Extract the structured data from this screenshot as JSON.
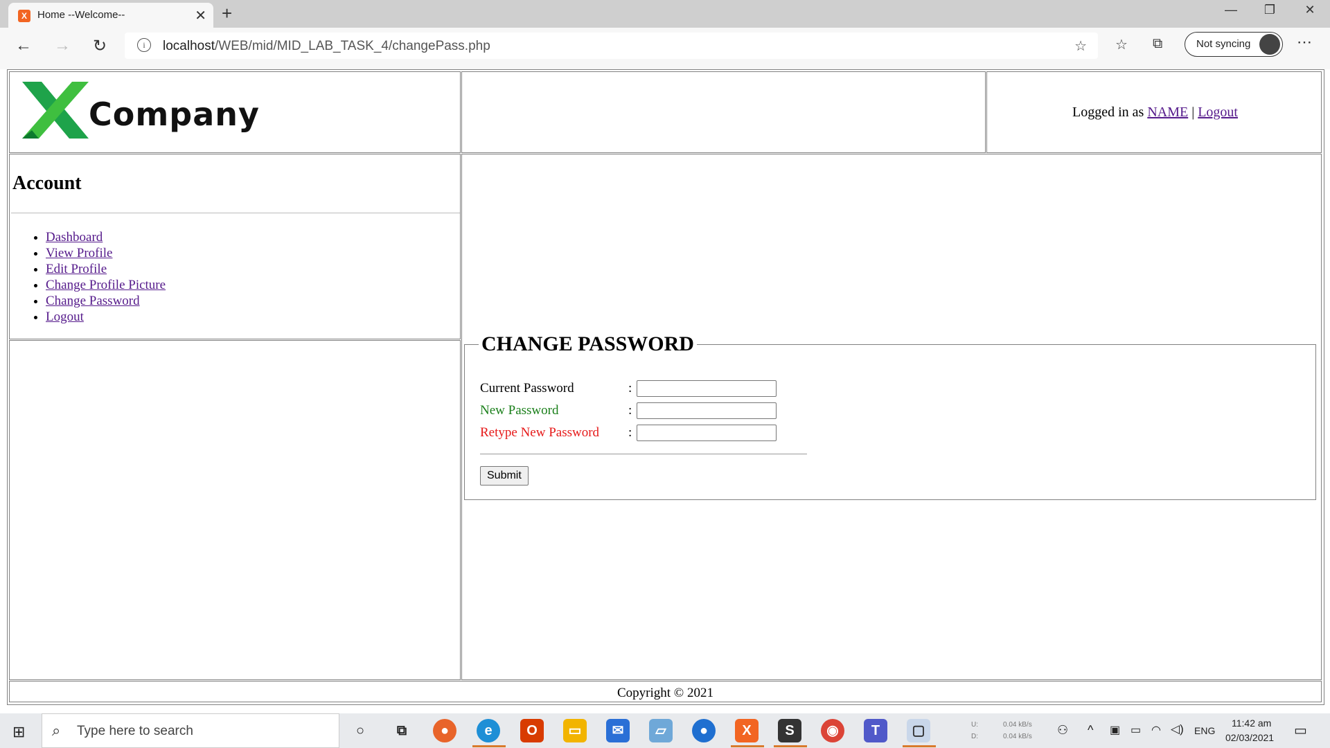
{
  "browser": {
    "tab_title": "Home --Welcome--",
    "tab_favicon_letter": "X",
    "url_host": "localhost",
    "url_path": "/WEB/mid/MID_LAB_TASK_4/changePass.php",
    "sync_label": "Not syncing"
  },
  "header": {
    "logo_letter": "X",
    "logo_text": "Company",
    "logged_in_prefix": "Logged in as",
    "user_name": "NAME",
    "separator": "|",
    "logout_label": "Logout"
  },
  "sidebar": {
    "title": "Account",
    "items": [
      {
        "label": "Dashboard"
      },
      {
        "label": "View Profile"
      },
      {
        "label": "Edit Profile"
      },
      {
        "label": "Change Profile Picture"
      },
      {
        "label": "Change Password"
      },
      {
        "label": "Logout"
      }
    ]
  },
  "form": {
    "legend": "CHANGE PASSWORD",
    "fields": [
      {
        "label": "Current Password",
        "color": "#000000",
        "colon": ":",
        "value": ""
      },
      {
        "label": "New Password",
        "color": "#1a7f1a",
        "colon": ":",
        "value": ""
      },
      {
        "label": "Retype New Password",
        "color": "#e61919",
        "colon": ":",
        "value": ""
      }
    ],
    "submit_label": "Submit"
  },
  "footer": {
    "copyright": "Copyright © 2021"
  },
  "taskbar": {
    "search_placeholder": "Type here to search",
    "net_up": "0.04 kB/s",
    "net_down": "0.04 kB/s",
    "net_up_label": "U:",
    "net_down_label": "D:",
    "language": "ENG",
    "time": "11:42 am",
    "date": "02/03/2021"
  }
}
